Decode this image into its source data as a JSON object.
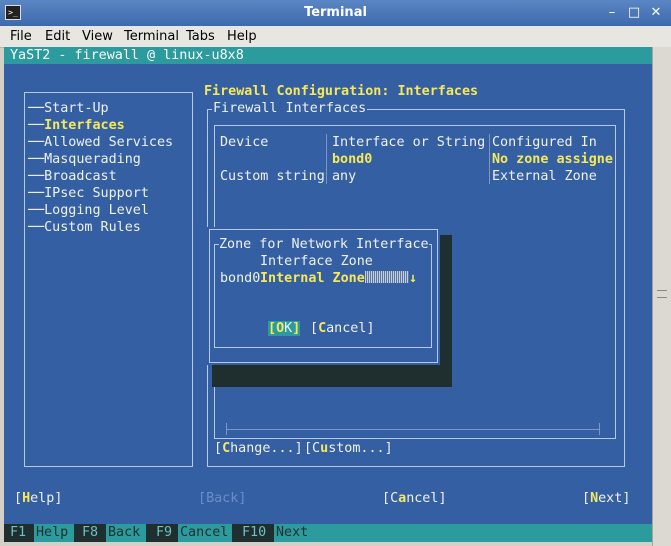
{
  "window": {
    "title": "Terminal",
    "app_icon": "terminal-icon",
    "buttons": [
      "minimize-icon",
      "maximize-icon",
      "close-icon"
    ]
  },
  "menu": [
    "File",
    "Edit",
    "View",
    "Terminal",
    "Tabs",
    "Help"
  ],
  "yast": {
    "header": "YaST2 - firewall @ linux-u8x8",
    "page_title": "Firewall Configuration: Interfaces",
    "nav_tree": [
      {
        "label": "Start-Up",
        "selected": false
      },
      {
        "label": "Interfaces",
        "selected": true
      },
      {
        "label": "Allowed Services",
        "selected": false
      },
      {
        "label": "Masquerading",
        "selected": false
      },
      {
        "label": "Broadcast",
        "selected": false
      },
      {
        "label": "IPsec Support",
        "selected": false
      },
      {
        "label": "Logging Level",
        "selected": false
      },
      {
        "label": "Custom Rules",
        "selected": false
      }
    ],
    "frame_title": "Firewall Interfaces",
    "table": {
      "headers": [
        "Device",
        "Interface or String",
        "Configured In"
      ],
      "rows": [
        [
          "",
          "bond0",
          "No zone assigne"
        ],
        [
          "Custom string",
          "any",
          "External Zone"
        ]
      ]
    },
    "change_button": "[Change...]",
    "custom_button": "[Custom...]",
    "dialog": {
      "title": "Zone for Network Interface",
      "label": "Interface Zone",
      "device": "bond0",
      "zone_value": "Internal Zone",
      "dropdown_arrow": "↓",
      "ok_label": "OK",
      "cancel_label": "Cancel"
    },
    "bottom_buttons": {
      "help": "Help",
      "back": "Back",
      "cancel": "Cancel",
      "next": "Next"
    },
    "fkeys": [
      {
        "key": "F1",
        "label": "Help"
      },
      {
        "key": "F8",
        "label": "Back"
      },
      {
        "key": "F9",
        "label": "Cancel"
      },
      {
        "key": "F10",
        "label": "Next"
      }
    ]
  }
}
